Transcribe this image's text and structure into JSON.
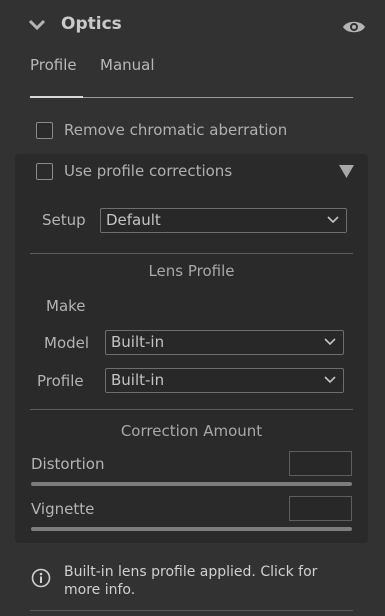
{
  "header": {
    "title": "Optics"
  },
  "tabs": [
    {
      "label": "Profile",
      "active": true
    },
    {
      "label": "Manual",
      "active": false
    }
  ],
  "remove_ca": {
    "label": "Remove chromatic aberration",
    "checked": false
  },
  "profile_corrections": {
    "label": "Use profile corrections",
    "checked": false,
    "setup": {
      "label": "Setup",
      "value": "Default"
    },
    "lens_profile": {
      "title": "Lens Profile",
      "make_label": "Make",
      "model": {
        "label": "Model",
        "value": "Built-in"
      },
      "profile": {
        "label": "Profile",
        "value": "Built-in"
      }
    },
    "correction_amount": {
      "title": "Correction Amount",
      "distortion_label": "Distortion",
      "vignette_label": "Vignette"
    }
  },
  "info": {
    "text": "Built-in lens profile applied.  Click for more info."
  },
  "colors": {
    "background": "#323232",
    "panel": "#2a2a2a",
    "text": "#bdbdbd"
  }
}
